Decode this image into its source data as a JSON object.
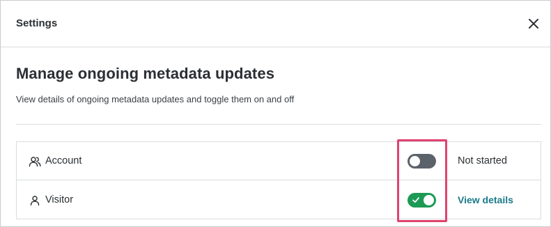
{
  "dialog": {
    "title": "Settings"
  },
  "page": {
    "title": "Manage ongoing metadata updates",
    "description": "View details of ongoing metadata updates and toggle them on and off"
  },
  "rows": [
    {
      "label": "Account",
      "icon": "users-icon",
      "enabled": false,
      "status": "Not started"
    },
    {
      "label": "Visitor",
      "icon": "user-icon",
      "enabled": true,
      "link": "View details"
    }
  ],
  "colors": {
    "toggle_off": "#5c6269",
    "toggle_on": "#1c9a55",
    "link": "#1a7a8a",
    "highlight": "#e0426f"
  }
}
